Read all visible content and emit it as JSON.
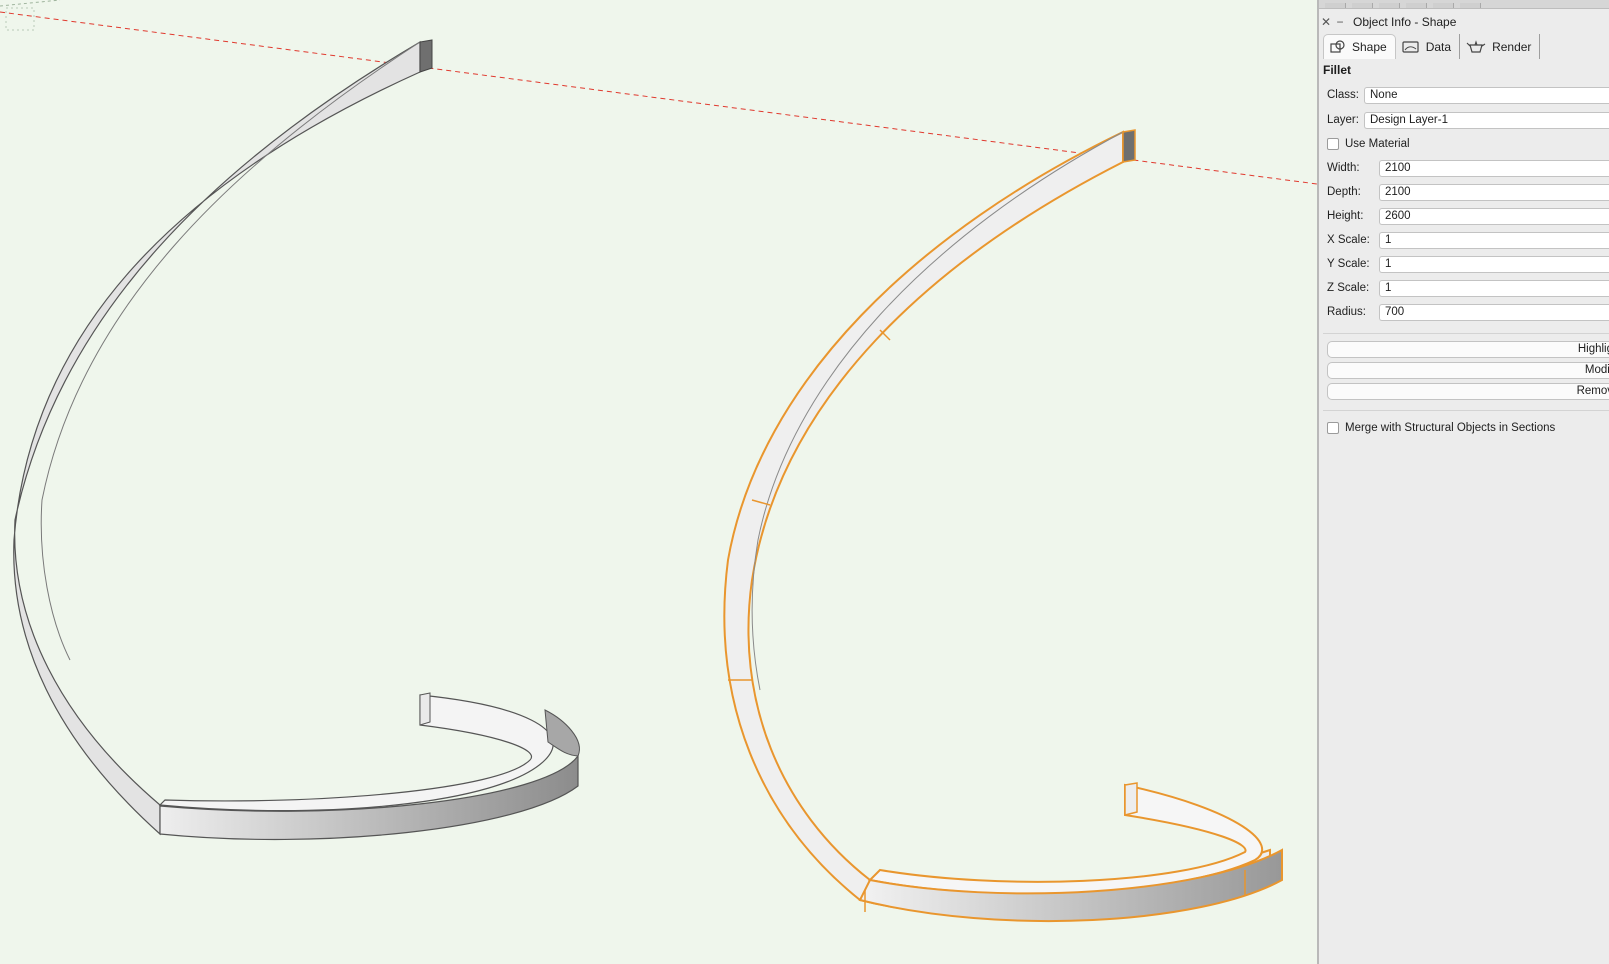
{
  "panel": {
    "title": "Object Info - Shape",
    "tabs": [
      {
        "label": "Shape",
        "icon": "shape-icon"
      },
      {
        "label": "Data",
        "icon": "data-icon"
      },
      {
        "label": "Render",
        "icon": "teapot-icon"
      }
    ],
    "object_type": "Fillet",
    "class_label": "Class:",
    "class_value": "None",
    "layer_label": "Layer:",
    "layer_value": "Design Layer-1",
    "use_material_label": "Use Material",
    "fields": [
      {
        "label": "Width:",
        "value": "2100"
      },
      {
        "label": "Depth:",
        "value": "2100"
      },
      {
        "label": "Height:",
        "value": "2600"
      },
      {
        "label": "X Scale:",
        "value": "1"
      },
      {
        "label": "Y Scale:",
        "value": "1"
      },
      {
        "label": "Z Scale:",
        "value": "1"
      },
      {
        "label": "Radius:",
        "value": "700"
      }
    ],
    "buttons": [
      "Highlig",
      "Modif",
      "Remov"
    ],
    "merge_label": "Merge with Structural Objects in Sections"
  },
  "colors": {
    "viewport_bg": "#eff6ec",
    "selection": "#e9962e",
    "working_plane_line": "#e0392e"
  }
}
